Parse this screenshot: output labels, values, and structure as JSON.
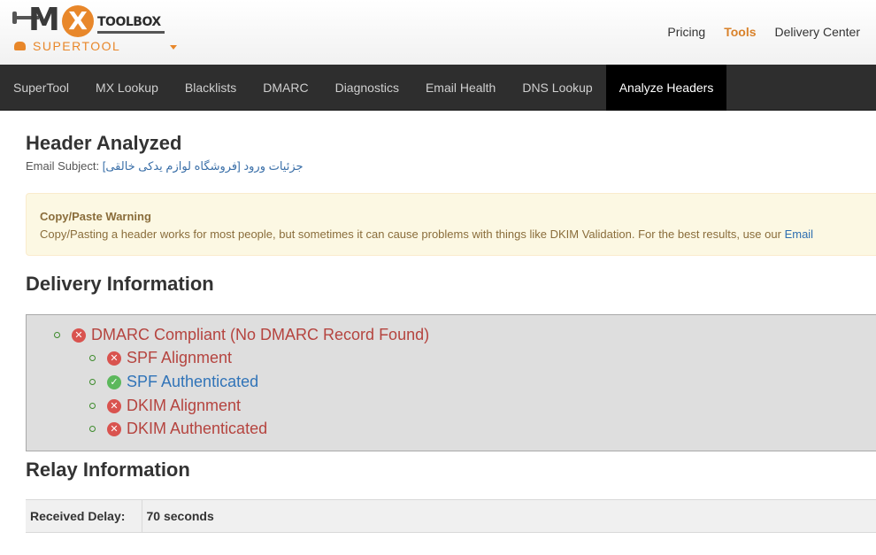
{
  "brand": {
    "logo_mx": "MX",
    "logo_toolbox": "TOOLBOX",
    "product": "SUPERTOOL"
  },
  "top_links": [
    {
      "label": "Pricing",
      "active": false
    },
    {
      "label": "Tools",
      "active": true
    },
    {
      "label": "Delivery Center",
      "active": false
    }
  ],
  "nav": [
    {
      "label": "SuperTool",
      "active": false
    },
    {
      "label": "MX Lookup",
      "active": false
    },
    {
      "label": "Blacklists",
      "active": false
    },
    {
      "label": "DMARC",
      "active": false
    },
    {
      "label": "Diagnostics",
      "active": false
    },
    {
      "label": "Email Health",
      "active": false
    },
    {
      "label": "DNS Lookup",
      "active": false
    },
    {
      "label": "Analyze Headers",
      "active": true
    }
  ],
  "header": {
    "title": "Header Analyzed",
    "subject_label": "Email Subject:",
    "subject_value": "جزئیات ورود [فروشگاه لوازم یدکی خالقی]"
  },
  "warning": {
    "title": "Copy/Paste Warning",
    "text": "Copy/Pasting a header works for most people, but sometimes it can cause problems with things like DKIM Validation. For the best results, use our",
    "link": "Email"
  },
  "delivery": {
    "title": "Delivery Information",
    "items": [
      {
        "label": "DMARC Compliant (No DMARC Record Found)",
        "status": "fail",
        "icon": "x-circle-icon"
      },
      {
        "label": "SPF Alignment",
        "status": "fail",
        "icon": "x-circle-icon"
      },
      {
        "label": "SPF Authenticated",
        "status": "pass",
        "icon": "check-circle-icon"
      },
      {
        "label": "DKIM Alignment",
        "status": "fail",
        "icon": "x-circle-icon"
      },
      {
        "label": "DKIM Authenticated",
        "status": "fail",
        "icon": "x-circle-icon"
      }
    ]
  },
  "relay": {
    "title": "Relay Information",
    "rows": [
      {
        "key": "Received Delay:",
        "value": "70 seconds"
      }
    ]
  },
  "colors": {
    "accent": "#e8872a",
    "nav_bg": "#2e2e2e",
    "fail": "#d9534f",
    "pass": "#5cb85c"
  }
}
